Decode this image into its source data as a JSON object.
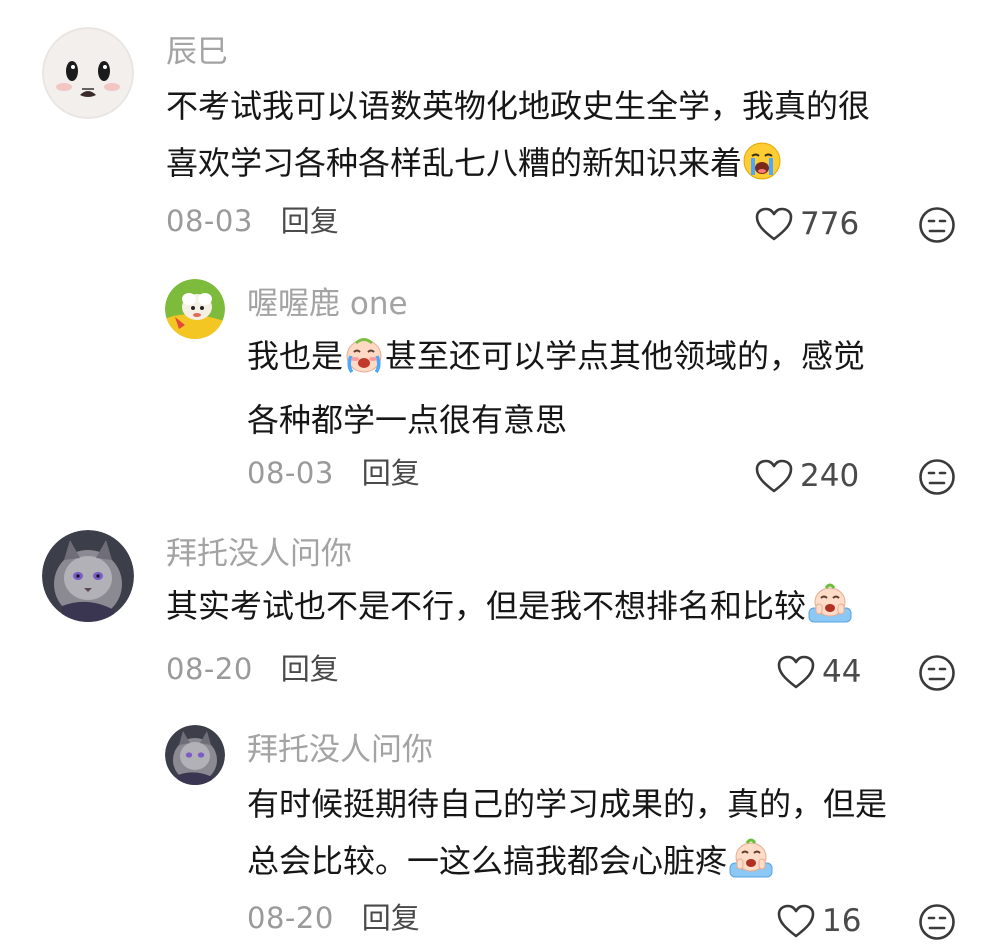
{
  "comments": [
    {
      "username": "辰巳",
      "text_lines": [
        "不考试我可以语数英物化地政史生全学，我真的很",
        "喜欢学习各种各样乱七八糟的新知识来着"
      ],
      "date": "08-03",
      "reply_label": "回复",
      "likes": "776",
      "emoji": "loudly-crying-emoji"
    },
    {
      "username": "喔喔鹿 one",
      "text_lines": [
        "我也是",
        "甚至还可以学点其他领域的，感觉",
        "各种都学一点很有意思"
      ],
      "date": "08-03",
      "reply_label": "回复",
      "likes": "240",
      "emoji": "crying-baby-emoji"
    },
    {
      "username": "拜托没人问你",
      "text_lines": [
        "其实考试也不是不行，但是我不想排名和比较"
      ],
      "date": "08-20",
      "reply_label": "回复",
      "likes": "44",
      "emoji": "crying-baby-sticker-emoji"
    },
    {
      "username": "拜托没人问你",
      "text_lines": [
        "有时候挺期待自己的学习成果的，真的，但是",
        "总会比较。一这么搞我都会心脏疼"
      ],
      "date": "08-20",
      "reply_label": "回复",
      "likes": "16",
      "emoji": "crying-baby-sticker-emoji"
    }
  ],
  "icons": {
    "like": "heart-outline-icon",
    "dislike": "meh-face-icon"
  },
  "colors": {
    "username": "#a3a3a3",
    "body_text": "#161616",
    "date": "#9a9a9a",
    "action": "#4a4a4a"
  }
}
